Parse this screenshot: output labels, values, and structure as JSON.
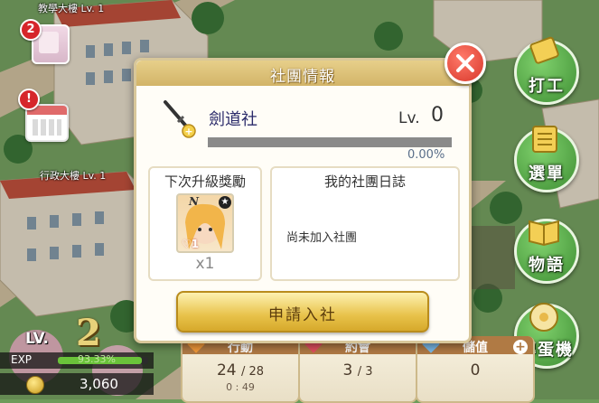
{
  "buildings": {
    "teaching": "教學大樓 Lv. 1",
    "admin": "行政大樓 Lv. 1"
  },
  "notifications": {
    "phone_badge": "2",
    "calendar_badge": "!"
  },
  "side_menu": [
    {
      "label": "打工",
      "icon": "briefcase-icon"
    },
    {
      "label": "選單",
      "icon": "list-icon"
    },
    {
      "label": "物語",
      "icon": "book-icon"
    },
    {
      "label": "轉蛋機",
      "icon": "flower-icon"
    }
  ],
  "player": {
    "lv_label": "LV.",
    "level": "2",
    "exp_label": "EXP",
    "exp_percent_text": "93.33%",
    "exp_fraction": 0.9333,
    "coins": "3,060"
  },
  "stats": {
    "action": {
      "title": "行動",
      "value": "24",
      "max": "28",
      "timer": "0 : 49"
    },
    "date": {
      "title": "約會",
      "value": "3",
      "max": "3"
    },
    "stored": {
      "title": "儲值",
      "value": "0"
    }
  },
  "dialog": {
    "title": "社團情報",
    "club_name": "劍道社",
    "lv_label": "Lv.",
    "lv_value": "0",
    "progress_text": "0.00%",
    "progress_fraction": 0.0,
    "reward_title": "下次升級獎勵",
    "reward_rarity": "N",
    "reward_heart_level": "1",
    "reward_qty": "x1",
    "diary_title": "我的社團日誌",
    "diary_text": "尚未加入社團",
    "join_button": "申請入社"
  },
  "colors": {
    "accent_gold": "#e8c24a",
    "close_red": "#d8382b",
    "exp_green": "#6ac23a",
    "menu_green": "#3f8f34"
  }
}
